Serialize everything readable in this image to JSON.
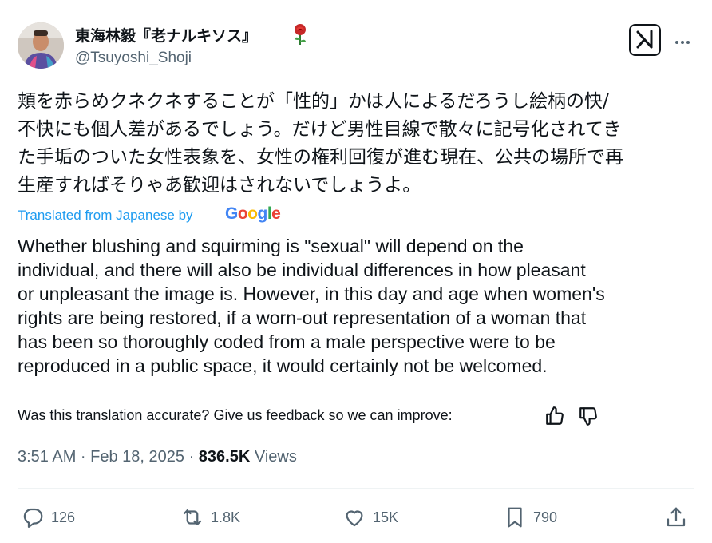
{
  "author": {
    "display_name": "東海林毅『老ナルキソス』",
    "handle": "@Tsuyoshi_Shoji",
    "name_emoji": "rose-icon"
  },
  "tweet": {
    "original_lines": [
      "頬を赤らめクネクネすることが「性的」かは人によるだろうし絵柄の快/",
      "不快にも個人差があるでしょう。だけど男性目線で散々に記号化されてき",
      "た手垢のついた女性表象を、女性の権利回復が進む現在、公共の場所で再",
      "生産すればそりゃあ歓迎はされないでしょうよ。"
    ],
    "translated_from": "Translated from Japanese by",
    "translation_provider": "Google",
    "translation_lines": [
      "Whether blushing and squirming is \"sexual\" will depend on the",
      "individual, and there will also be individual differences in how pleasant",
      "or unpleasant the image is. However, in this day and age when women's",
      "rights are being restored, if a worn-out representation of a woman that",
      "has been so thoroughly coded from a male perspective were to be",
      "reproduced in a public space, it would certainly not be welcomed."
    ],
    "feedback_prompt": "Was this translation accurate? Give us feedback so we can improve:",
    "timestamp": "3:51 AM · Feb 18, 2025 · ",
    "views_count": "836.5K",
    "views_label": " Views"
  },
  "actions": {
    "replies": "126",
    "reposts": "1.8K",
    "likes": "15K",
    "bookmarks": "790"
  },
  "colors": {
    "text_primary": "#0f1419",
    "text_secondary": "#536471",
    "link_blue": "#1d9bf0",
    "divider": "#eff3f4"
  }
}
